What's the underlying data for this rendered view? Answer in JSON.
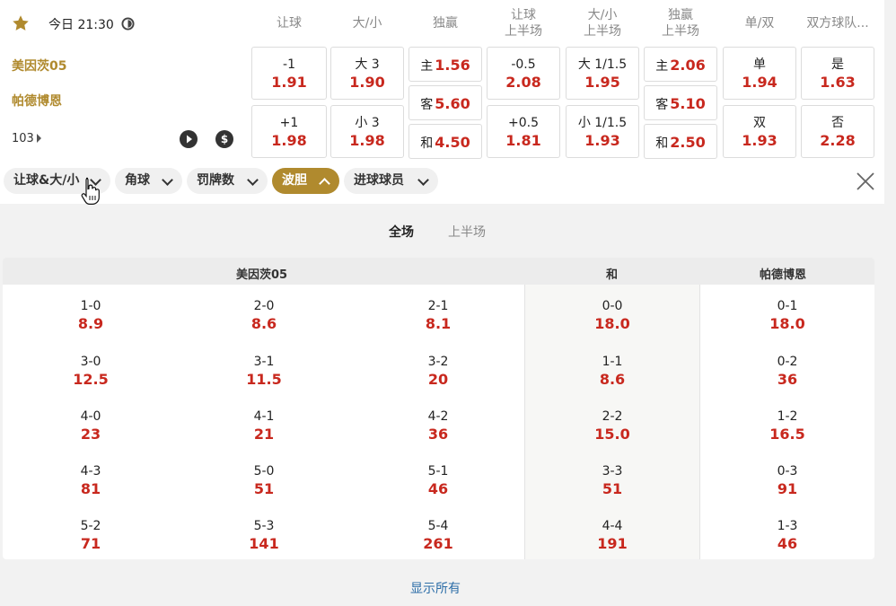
{
  "match": {
    "time": "今日 21:30",
    "home": "美因茨05",
    "away": "帕德博恩",
    "more_count": "103"
  },
  "headers": [
    [
      "让球"
    ],
    [
      "大/小"
    ],
    [
      "独赢"
    ],
    [
      "让球",
      "上半场"
    ],
    [
      "大/小",
      "上半场"
    ],
    [
      "独赢",
      "上半场"
    ],
    [
      "单/双"
    ],
    [
      "双方球队..."
    ]
  ],
  "odds": {
    "hcp": [
      {
        "label": "-1",
        "odd": "1.91"
      },
      {
        "label": "+1",
        "odd": "1.98"
      }
    ],
    "ou": [
      {
        "label": "大 3",
        "odd": "1.90"
      },
      {
        "label": "小 3",
        "odd": "1.98"
      }
    ],
    "mw": [
      {
        "label": "主",
        "odd": "1.56"
      },
      {
        "label": "客",
        "odd": "5.60"
      },
      {
        "label": "和",
        "odd": "4.50"
      }
    ],
    "hcp_h1": [
      {
        "label": "-0.5",
        "odd": "2.08"
      },
      {
        "label": "+0.5",
        "odd": "1.81"
      }
    ],
    "ou_h1": [
      {
        "label": "大 1/1.5",
        "odd": "1.95"
      },
      {
        "label": "小 1/1.5",
        "odd": "1.93"
      }
    ],
    "mw_h1": [
      {
        "label": "主",
        "odd": "2.06"
      },
      {
        "label": "客",
        "odd": "5.10"
      },
      {
        "label": "和",
        "odd": "2.50"
      }
    ],
    "oe": [
      {
        "label": "单",
        "odd": "1.94"
      },
      {
        "label": "双",
        "odd": "1.93"
      }
    ],
    "btts": [
      {
        "label": "是",
        "odd": "1.63"
      },
      {
        "label": "否",
        "odd": "2.28"
      }
    ]
  },
  "filters": [
    "让球&大/小",
    "角球",
    "罚牌数",
    "波胆",
    "进球球员"
  ],
  "active_filter": "波胆",
  "period_tabs": [
    "全场",
    "上半场"
  ],
  "correct_score": {
    "headers": [
      "美因茨05",
      "和",
      "帕德博恩"
    ],
    "home": [
      [
        {
          "s": "1-0",
          "o": "8.9"
        },
        {
          "s": "2-0",
          "o": "8.6"
        },
        {
          "s": "2-1",
          "o": "8.1"
        }
      ],
      [
        {
          "s": "3-0",
          "o": "12.5"
        },
        {
          "s": "3-1",
          "o": "11.5"
        },
        {
          "s": "3-2",
          "o": "20"
        }
      ],
      [
        {
          "s": "4-0",
          "o": "23"
        },
        {
          "s": "4-1",
          "o": "21"
        },
        {
          "s": "4-2",
          "o": "36"
        }
      ],
      [
        {
          "s": "4-3",
          "o": "81"
        },
        {
          "s": "5-0",
          "o": "51"
        },
        {
          "s": "5-1",
          "o": "46"
        }
      ],
      [
        {
          "s": "5-2",
          "o": "71"
        },
        {
          "s": "5-3",
          "o": "141"
        },
        {
          "s": "5-4",
          "o": "261"
        }
      ]
    ],
    "draw": [
      {
        "s": "0-0",
        "o": "18.0"
      },
      {
        "s": "1-1",
        "o": "8.6"
      },
      {
        "s": "2-2",
        "o": "15.0"
      },
      {
        "s": "3-3",
        "o": "51"
      },
      {
        "s": "4-4",
        "o": "191"
      }
    ],
    "away": [
      {
        "s": "0-1",
        "o": "18.0"
      },
      {
        "s": "0-2",
        "o": "36"
      },
      {
        "s": "1-2",
        "o": "16.5"
      },
      {
        "s": "0-3",
        "o": "91"
      },
      {
        "s": "1-3",
        "o": "46"
      }
    ]
  },
  "show_all": "显示所有",
  "colors": {
    "gold": "#b08a2e",
    "odds_red": "#c8281e",
    "link_blue": "#2d6ea8"
  }
}
